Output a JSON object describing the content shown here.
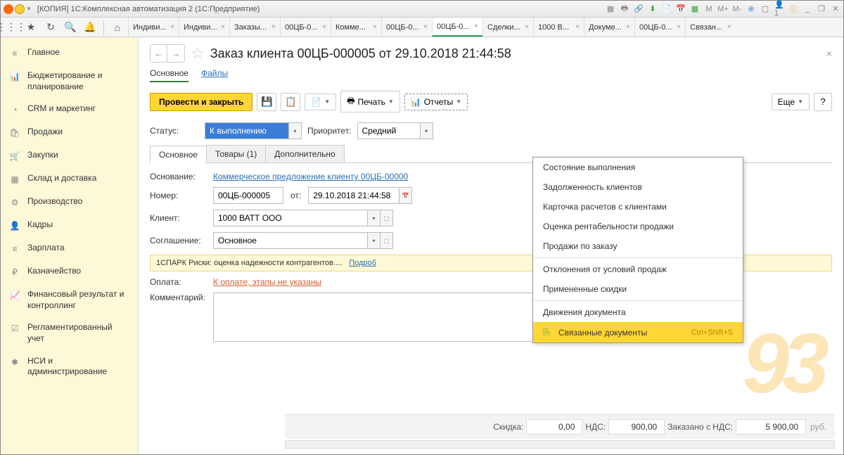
{
  "app": {
    "title": "[КОПИЯ] 1С:Комплексная автоматизация 2  (1С:Предприятие)"
  },
  "tabs": [
    {
      "label": "Индиви..."
    },
    {
      "label": "Индиви..."
    },
    {
      "label": "Заказы..."
    },
    {
      "label": "00ЦБ-0..."
    },
    {
      "label": "Комме..."
    },
    {
      "label": "00ЦБ-0..."
    },
    {
      "label": "00ЦБ-0...",
      "active": true
    },
    {
      "label": "Сделки..."
    },
    {
      "label": "1000 В..."
    },
    {
      "label": "Докуме..."
    },
    {
      "label": "00ЦБ-0..."
    },
    {
      "label": "Связан..."
    }
  ],
  "sidebar": [
    {
      "icon": "≡",
      "label": "Главное"
    },
    {
      "icon": "📊",
      "label": "Бюджетирование и планирование"
    },
    {
      "icon": "◔",
      "label": "CRM и маркетинг"
    },
    {
      "icon": "🛍",
      "label": "Продажи"
    },
    {
      "icon": "🛒",
      "label": "Закупки"
    },
    {
      "icon": "▦",
      "label": "Склад и доставка"
    },
    {
      "icon": "⚙",
      "label": "Производство"
    },
    {
      "icon": "👤",
      "label": "Кадры"
    },
    {
      "icon": "≡",
      "label": "Зарплата"
    },
    {
      "icon": "₽",
      "label": "Казначейство"
    },
    {
      "icon": "📈",
      "label": "Финансовый результат и контроллинг"
    },
    {
      "icon": "☑",
      "label": "Регламентированный учет"
    },
    {
      "icon": "✱",
      "label": "НСИ и администрирование"
    }
  ],
  "page": {
    "title": "Заказ клиента 00ЦБ-000005 от 29.10.2018 21:44:58",
    "subtabs": {
      "main": "Основное",
      "files": "Файлы"
    }
  },
  "toolbar": {
    "primary": "Провести и закрыть",
    "print": "Печать",
    "reports": "Отчеты",
    "more": "Еще",
    "help": "?"
  },
  "status_row": {
    "status_label": "Статус:",
    "status_value": "К выполнению",
    "priority_label": "Приоритет:",
    "priority_value": "Средний"
  },
  "doc_tabs": {
    "main": "Основное",
    "goods": "Товары (1)",
    "extra": "Дополнительно"
  },
  "form": {
    "basis_label": "Основание:",
    "basis_value": "Коммерческое предложение клиенту 00ЦБ-00000",
    "number_label": "Номер:",
    "number_value": "00ЦБ-000005",
    "from_label": "от:",
    "date_value": "29.10.2018 21:44:58",
    "client_label": "Клиент:",
    "client_value": "1000 ВАТТ ООО",
    "agreement_label": "Соглашение:",
    "agreement_value": "Основное",
    "payment_label": "Оплата:",
    "payment_link": "К оплате, этапы не указаны",
    "comment_label": "Комментарий:"
  },
  "banner": {
    "text": "1СПАРК Риски: оценка надежности контрагентов....",
    "link": "Подроб"
  },
  "dropdown": {
    "items": [
      "Состояние выполнения",
      "Задолженность клиентов",
      "Карточка расчетов с клиентами",
      "Оценка рентабельности продажи",
      "Продажи по заказу",
      "Отклонения от условий продаж",
      "Примененные скидки",
      "Движения документа"
    ],
    "highlight_label": "Связанные документы",
    "highlight_shortcut": "Ctrl+Shift+S"
  },
  "footer": {
    "discount_label": "Скидка:",
    "discount_value": "0,00",
    "vat_label": "НДС:",
    "vat_value": "900,00",
    "total_label": "Заказано с НДС:",
    "total_value": "5 900,00",
    "currency": "руб."
  },
  "watermark": "93"
}
